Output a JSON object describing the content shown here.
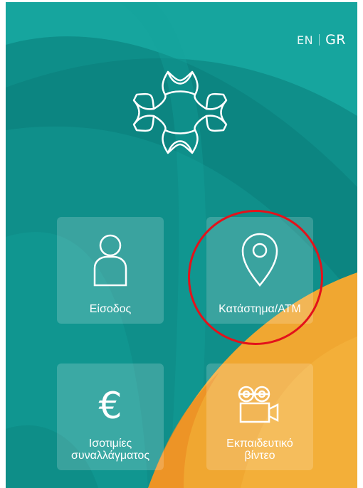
{
  "colors": {
    "teal_base": "#0f8f8a",
    "teal_light": "#17a7a0",
    "teal_dark": "#0a7f7b",
    "orange": "#f0a731",
    "orange_deep": "#eb8c22",
    "highlight": "#e3121b"
  },
  "language": {
    "en": "EN",
    "gr": "GR",
    "selected": "GR"
  },
  "logo": {
    "icon": "bank-snowflake-logo"
  },
  "tiles": [
    {
      "id": "login",
      "label": "Είσοδος",
      "icon": "person-icon"
    },
    {
      "id": "store_atm",
      "label": "Κατάστημα/ΑΤΜ",
      "icon": "map-pin-icon"
    },
    {
      "id": "fx_rates",
      "label_line1": "Ισοτιμίες",
      "label_line2": "συναλλάγματος",
      "icon": "euro-icon"
    },
    {
      "id": "video",
      "label_line1": "Εκπαιδευτικό",
      "label_line2": "βίντεο",
      "icon": "video-camera-icon"
    }
  ],
  "euro_symbol": "€"
}
